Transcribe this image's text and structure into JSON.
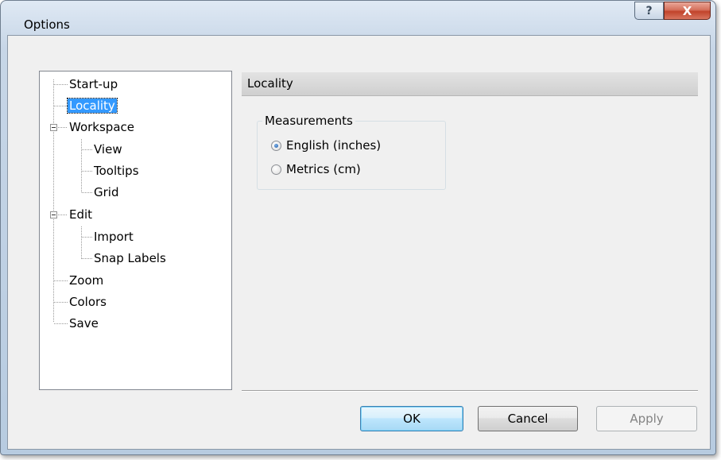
{
  "window": {
    "title": "Options",
    "help_glyph": "?",
    "close_glyph": "X"
  },
  "tree": {
    "items": [
      {
        "label": "Start-up"
      },
      {
        "label": "Locality",
        "selected": true
      },
      {
        "label": "Workspace",
        "expanded": true
      },
      {
        "label": "View"
      },
      {
        "label": "Tooltips"
      },
      {
        "label": "Grid"
      },
      {
        "label": "Edit",
        "expanded": true
      },
      {
        "label": "Import"
      },
      {
        "label": "Snap Labels"
      },
      {
        "label": "Zoom"
      },
      {
        "label": "Colors"
      },
      {
        "label": "Save"
      }
    ]
  },
  "panel": {
    "header": "Locality",
    "group_label": "Measurements",
    "options": [
      {
        "label": "English (inches)",
        "checked": true
      },
      {
        "label": "Metrics (cm)",
        "checked": false
      }
    ]
  },
  "buttons": {
    "ok": "OK",
    "cancel": "Cancel",
    "apply": "Apply"
  }
}
